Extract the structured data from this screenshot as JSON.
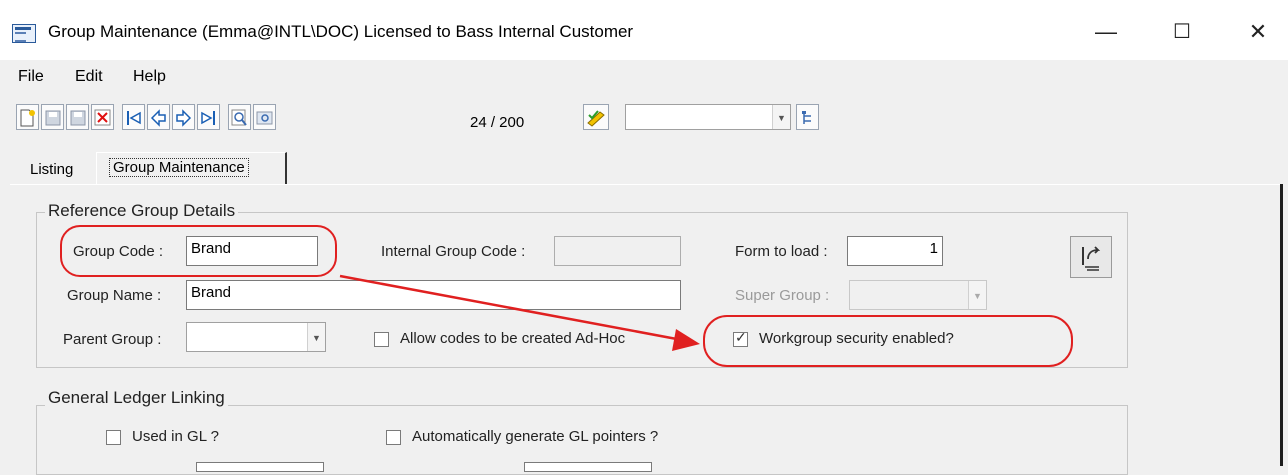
{
  "window": {
    "title": "Group Maintenance (Emma@INTL\\DOC) Licensed to Bass Internal Customer",
    "controls": {
      "minimize": "—",
      "maximize": "☐",
      "close": "✕"
    }
  },
  "menu": [
    {
      "label": "File"
    },
    {
      "label": "Edit"
    },
    {
      "label": "Help"
    }
  ],
  "toolbar": {
    "record_counter": "24 / 200",
    "combo_value": ""
  },
  "tabs": [
    {
      "label": "Listing"
    },
    {
      "label": "Group Maintenance"
    }
  ],
  "reference": {
    "legend": "Reference Group Details",
    "group_code_label": "Group Code :",
    "group_code": "Brand",
    "internal_code_label": "Internal Group Code :",
    "internal_code": "",
    "form_label": "Form to load :",
    "form_value": "1",
    "group_name_label": "Group Name :",
    "group_name": "Brand",
    "super_group_label": "Super Group :",
    "super_group": "",
    "parent_group_label": "Parent Group :",
    "parent_group": "",
    "adhoc_label": "Allow codes to be created Ad-Hoc",
    "workgroup_label": "Workgroup security enabled?",
    "workgroup_checked": true
  },
  "gl": {
    "legend": "General Ledger Linking",
    "used_label": "Used in GL ?",
    "auto_label": "Automatically generate GL pointers ?"
  },
  "colors": {
    "annotation": "#e02020",
    "accent": "#2a5a9a"
  }
}
